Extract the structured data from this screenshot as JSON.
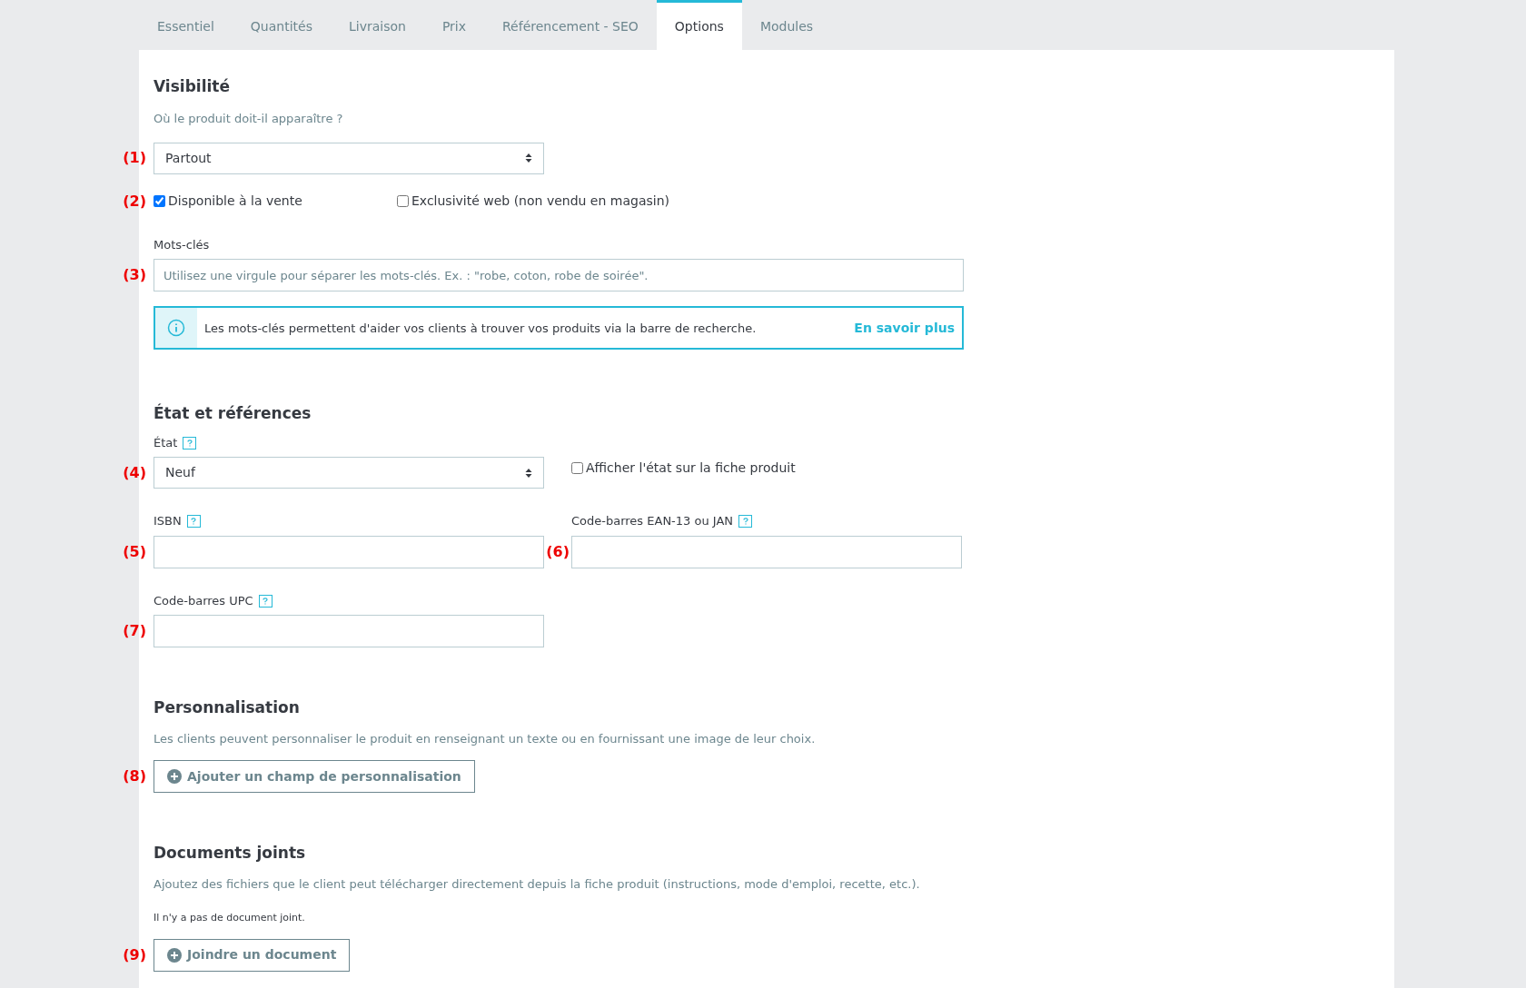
{
  "tabs": [
    {
      "label": "Essentiel",
      "selected": false
    },
    {
      "label": "Quantités",
      "selected": false
    },
    {
      "label": "Livraison",
      "selected": false
    },
    {
      "label": "Prix",
      "selected": false
    },
    {
      "label": "Référencement - SEO",
      "selected": false
    },
    {
      "label": "Options",
      "selected": true
    },
    {
      "label": "Modules",
      "selected": false
    }
  ],
  "visibility": {
    "title": "Visibilité",
    "subtitle": "Où le produit doit-il apparaître ?",
    "select": {
      "marker": "(1)",
      "value": "Partout"
    },
    "checkbox_marker": "(2)",
    "checkboxes": [
      {
        "label": "Disponible à la vente",
        "checked": true
      },
      {
        "label": "Exclusivité web (non vendu en magasin)",
        "checked": false
      }
    ],
    "keywords": {
      "label": "Mots-clés",
      "marker": "(3)",
      "placeholder": "Utilisez une virgule pour séparer les mots-clés. Ex. : \"robe, coton, robe de soirée\"."
    },
    "info": {
      "text": "Les mots-clés permettent d'aider vos clients à trouver vos produits via la barre de recherche.",
      "link": "En savoir plus"
    }
  },
  "condition": {
    "title": "État et références",
    "state": {
      "label": "État",
      "marker": "(4)",
      "value": "Neuf"
    },
    "show_state": {
      "label": "Afficher l'état sur la fiche produit",
      "checked": false
    },
    "fields": [
      {
        "label": "ISBN",
        "marker": "(5)"
      },
      {
        "label": "Code-barres EAN-13 ou JAN",
        "marker": "(6)"
      },
      {
        "label": "Code-barres UPC",
        "marker": "(7)"
      }
    ]
  },
  "customization": {
    "title": "Personnalisation",
    "text": "Les clients peuvent personnaliser le produit en renseignant un texte ou en fournissant une image de leur choix.",
    "marker": "(8)",
    "button": "Ajouter un champ de personnalisation"
  },
  "attachments": {
    "title": "Documents joints",
    "text": "Ajoutez des fichiers que le client peut télécharger directement depuis la fiche produit (instructions, mode d'emploi, recette, etc.).",
    "empty": "Il n'y a pas de document joint.",
    "marker": "(9)",
    "button": "Joindre un document"
  }
}
